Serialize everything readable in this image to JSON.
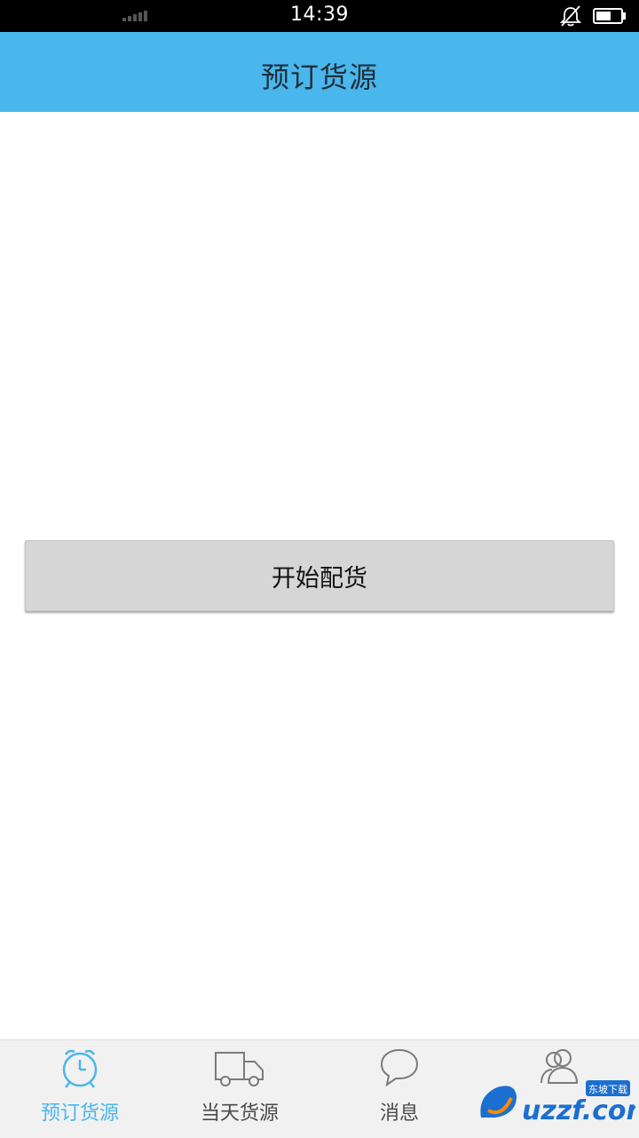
{
  "status_bar": {
    "time": "14:39",
    "icons": [
      "signal-icon",
      "mute-icon",
      "battery-icon"
    ],
    "battery_level": 0.6
  },
  "header": {
    "title": "预订货源",
    "background": "#49b6ec"
  },
  "main": {
    "start_button_label": "开始配货"
  },
  "bottom_nav": {
    "active_index": 0,
    "active_color": "#49b6ec",
    "items": [
      {
        "label": "预订货源",
        "icon": "alarm-clock-icon"
      },
      {
        "label": "当天货源",
        "icon": "truck-icon"
      },
      {
        "label": "消息",
        "icon": "chat-bubble-icon"
      },
      {
        "label": "",
        "icon": "contacts-icon"
      }
    ]
  },
  "watermark": {
    "text": "uzzf.com",
    "tag": "东坡下载"
  }
}
